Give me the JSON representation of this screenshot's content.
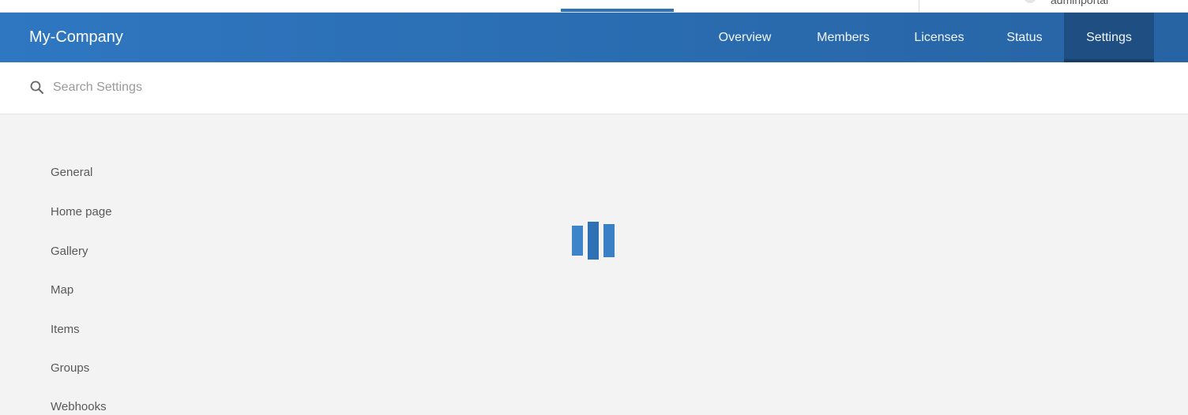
{
  "top_strip": {
    "username": "adminportal"
  },
  "header": {
    "brand": "My-Company",
    "nav": [
      {
        "label": "Overview",
        "active": false
      },
      {
        "label": "Members",
        "active": false
      },
      {
        "label": "Licenses",
        "active": false
      },
      {
        "label": "Status",
        "active": false
      },
      {
        "label": "Settings",
        "active": true
      }
    ]
  },
  "search": {
    "placeholder": "Search Settings",
    "value": "",
    "icon": "search-icon"
  },
  "sidebar": {
    "items": [
      {
        "label": "General"
      },
      {
        "label": "Home page"
      },
      {
        "label": "Gallery"
      },
      {
        "label": "Map"
      },
      {
        "label": "Items"
      },
      {
        "label": "Groups"
      },
      {
        "label": "Webhooks"
      }
    ]
  },
  "loader": {
    "icon": "loading-indicator-icon"
  },
  "colors": {
    "header_blue": "#2a6cb0",
    "active_tab": "#1f4f82",
    "loader_blue": "#3a80c5",
    "background": "#f3f3f3"
  }
}
